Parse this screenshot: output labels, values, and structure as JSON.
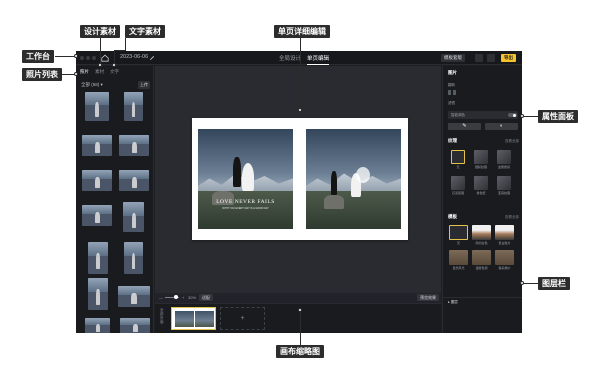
{
  "callouts": {
    "workspace": "工作台",
    "photo_list": "照片列表",
    "design_assets": "设计素材",
    "text_assets": "文字素材",
    "page_editor": "单页详细编辑",
    "properties_panel": "属性面板",
    "layers_bar": "图层栏",
    "canvas_thumbnails": "画布缩略图"
  },
  "topbar": {
    "date": "2023-06-06",
    "tabs": [
      {
        "label": "全局设计",
        "active": false
      },
      {
        "label": "单页编辑",
        "active": true
      }
    ],
    "template_btn": "模板套版",
    "export_btn": "导出"
  },
  "left_panel": {
    "tabs": [
      {
        "label": "照片",
        "active": true
      },
      {
        "label": "素材",
        "active": false
      },
      {
        "label": "文字",
        "active": false
      }
    ],
    "filter": "全部 (58) ▾",
    "upload": "上传"
  },
  "canvas": {
    "photo_title": "LOVE NEVER FAILS",
    "photo_subtitle": "WITH YOU EVERY DAY IS A GOOD DAY"
  },
  "zoom_bar": {
    "minus": "—",
    "plus": "+",
    "zoom": "30%",
    "fit_btn": "适配",
    "preview_btn": "预览效果"
  },
  "thumb_strip": {
    "side_label": "全部页面",
    "add": "+"
  },
  "right_panel": {
    "section_title": "图片",
    "flip_label": "翻转",
    "filter_label": "滤镜",
    "smart_label": "智能调色",
    "tools": [
      "✎",
      "◐"
    ],
    "texture_title": "纹理",
    "more": "查看全部",
    "textures": [
      "无",
      "细腻纹理",
      "金属质感",
      "石墨肌理",
      "素色纸",
      "亚麻纹理"
    ],
    "template_title": "模板",
    "templates": [
      "无",
      "简约白色",
      "复古胶片",
      "自然风光",
      "温暖色调",
      "森系婚纱"
    ],
    "layers_label": "▸ 图层"
  }
}
